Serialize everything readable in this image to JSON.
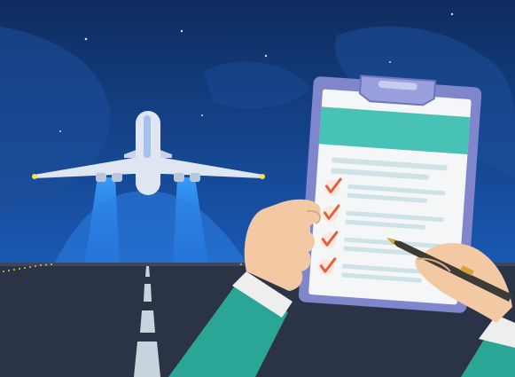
{
  "scene": {
    "subject": "airplane-takeoff-checklist",
    "colors": {
      "sky_top": "#0f2c5e",
      "sky_bottom": "#1a59b4",
      "cloud": "#1d4f9a",
      "runway": "#2b3447",
      "runway_stripe": "#c9d3dd",
      "runway_lights": "#e5c531",
      "plane_body": "#dfe6f2",
      "plane_accent": "#6fa3e8",
      "exhaust": "#2f8cf0",
      "clipboard_frame": "#7f86cc",
      "paper": "#f4f6f8",
      "header_band": "#47c2b4",
      "text_line": "#cfe3e7",
      "check": "#e0643a",
      "skin": "#f2c9a2",
      "sleeve": "#2aa596",
      "cuff": "#eeeeee",
      "pen_body": "#3d3b36",
      "pen_gold": "#d4a334"
    },
    "checklist": {
      "items": [
        {
          "checked": true
        },
        {
          "checked": true
        },
        {
          "checked": true
        },
        {
          "checked": true
        }
      ]
    }
  }
}
